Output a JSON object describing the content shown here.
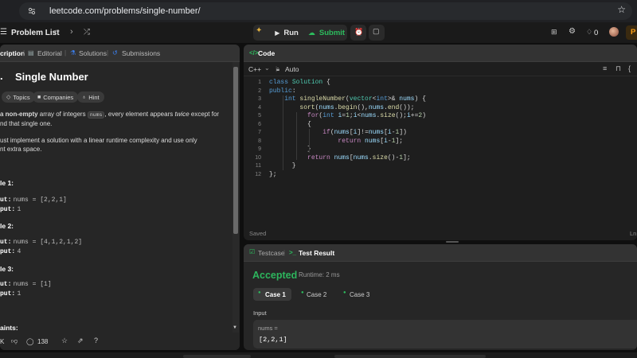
{
  "browser": {
    "url": "leetcode.com/problems/single-number/"
  },
  "topnav": {
    "problem_list": "Problem List",
    "run": "Run",
    "submit": "Submit",
    "fire_count": "0",
    "premium_letter": "P"
  },
  "left_panel": {
    "tabs": [
      "cription",
      "Editorial",
      "Solutions",
      "Submissions"
    ],
    "title": "Single Number",
    "chips": [
      "Topics",
      "Companies",
      "Hint"
    ],
    "description": {
      "p1_bold": "non-empty",
      "p1_a": " array of integers ",
      "p1_code": "nums",
      "p1_b": ", every element appears ",
      "p1_italic": "twice",
      "p1_c": " except for",
      "p1_line2": "nd that single one.",
      "p2_line1": "ust implement a solution with a linear runtime complexity and use only",
      "p2_line2": "nt extra space."
    },
    "examples": [
      {
        "heading": "le 1:",
        "input_label": "ut:",
        "input": "nums = [2,2,1]",
        "output_label": "put:",
        "output": "1"
      },
      {
        "heading": "le 2:",
        "input_label": "ut:",
        "input": "nums = [4,1,2,1,2]",
        "output_label": "put:",
        "output": "4"
      },
      {
        "heading": "le 3:",
        "input_label": "ut:",
        "input": "nums = [1]",
        "output_label": "put:",
        "output": "1"
      }
    ],
    "constraints_heading": "aints:",
    "footer": {
      "likes": "K",
      "comments": "138"
    }
  },
  "code_panel": {
    "tab": "Code",
    "language": "C++",
    "mode": "Auto",
    "status": "Saved",
    "right_status": "Ln",
    "line_numbers": [
      "1",
      "2",
      "3",
      "4",
      "5",
      "6",
      "7",
      "8",
      "9",
      "10",
      "11",
      "12"
    ]
  },
  "test_panel": {
    "tabs": [
      "Testcase",
      "Test Result"
    ],
    "verdict": "Accepted",
    "runtime": "Runtime: 2 ms",
    "cases": [
      "Case 1",
      "Case 2",
      "Case 3"
    ],
    "input_label": "Input",
    "var_name": "nums =",
    "var_value": "[2,2,1]"
  },
  "colors": {
    "accepted": "#2db55d",
    "submit_green": "#2cbb5d",
    "run_text": "#e6e6e6",
    "premium": "#ffa116"
  }
}
